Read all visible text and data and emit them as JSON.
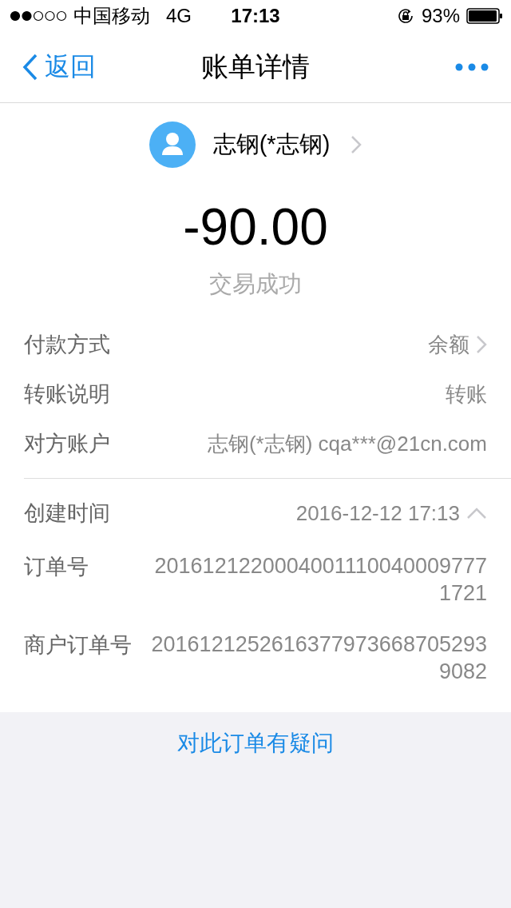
{
  "status_bar": {
    "carrier": "中国移动",
    "network": "4G",
    "time": "17:13",
    "battery": "93%"
  },
  "nav": {
    "back": "返回",
    "title": "账单详情"
  },
  "payee": {
    "name": "志钢(*志钢)"
  },
  "amount": "-90.00",
  "status": "交易成功",
  "details": [
    {
      "label": "付款方式",
      "value": "余额",
      "chevron": true
    },
    {
      "label": "转账说明",
      "value": "转账",
      "chevron": false
    },
    {
      "label": "对方账户",
      "value": "志钢(*志钢) cqa***@21cn.com",
      "chevron": false
    }
  ],
  "order": {
    "created_label": "创建时间",
    "created_value": "2016-12-12 17:13",
    "expanded": true,
    "rows": [
      {
        "label": "订单号",
        "value": "20161212200040011100400097771721"
      },
      {
        "label": "商户订单号",
        "value": "20161212526163779736687052939082"
      }
    ]
  },
  "question_link": "对此订单有疑问"
}
